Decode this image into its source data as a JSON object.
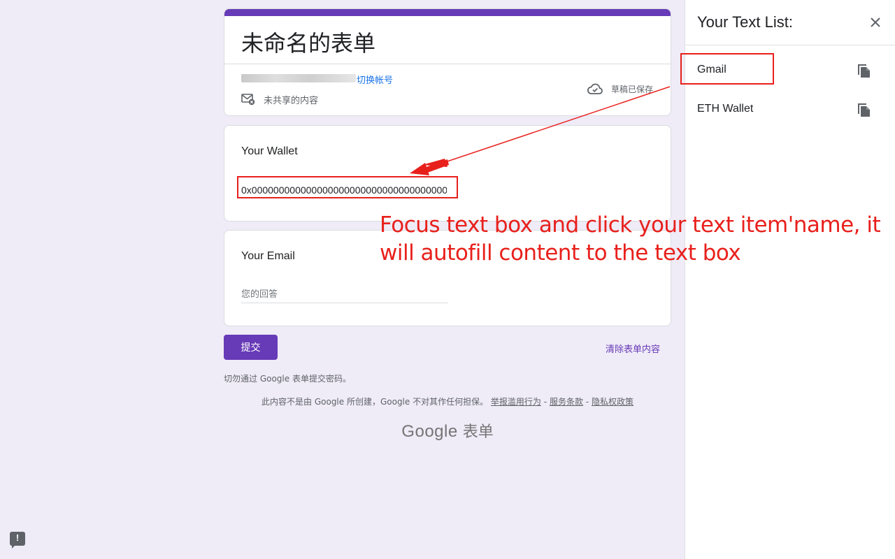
{
  "form": {
    "title": "未命名的表单",
    "switch_account": "切换帐号",
    "not_shared": "未共享的内容",
    "draft_saved": "草稿已保存",
    "questions": [
      {
        "label": "Your Wallet",
        "value": "0x00000000000000000000000000000000000000"
      },
      {
        "label": "Your Email",
        "placeholder": "您的回答"
      }
    ],
    "submit_label": "提交",
    "clear_label": "清除表单内容",
    "warning": "切勿通过 Google 表单提交密码。",
    "disclaimer": "此内容不是由 Google 所创建，Google 不对其作任何担保。",
    "links": [
      "举报滥用行为",
      "服务条款",
      "隐私权政策"
    ],
    "link_separator": "-",
    "brand_google": "Google",
    "brand_forms": "表单",
    "accent_color": "#673ab7"
  },
  "panel": {
    "title": "Your Text List:",
    "items": [
      {
        "name": "Gmail",
        "icon": "copy-icon"
      },
      {
        "name": "ETH Wallet",
        "icon": "copy-icon"
      }
    ]
  },
  "annotation": {
    "text": "Focus text box and click your text item'name, it will autofill content to the text box",
    "color": "#e8201c"
  },
  "feedback_icon": "feedback-icon"
}
